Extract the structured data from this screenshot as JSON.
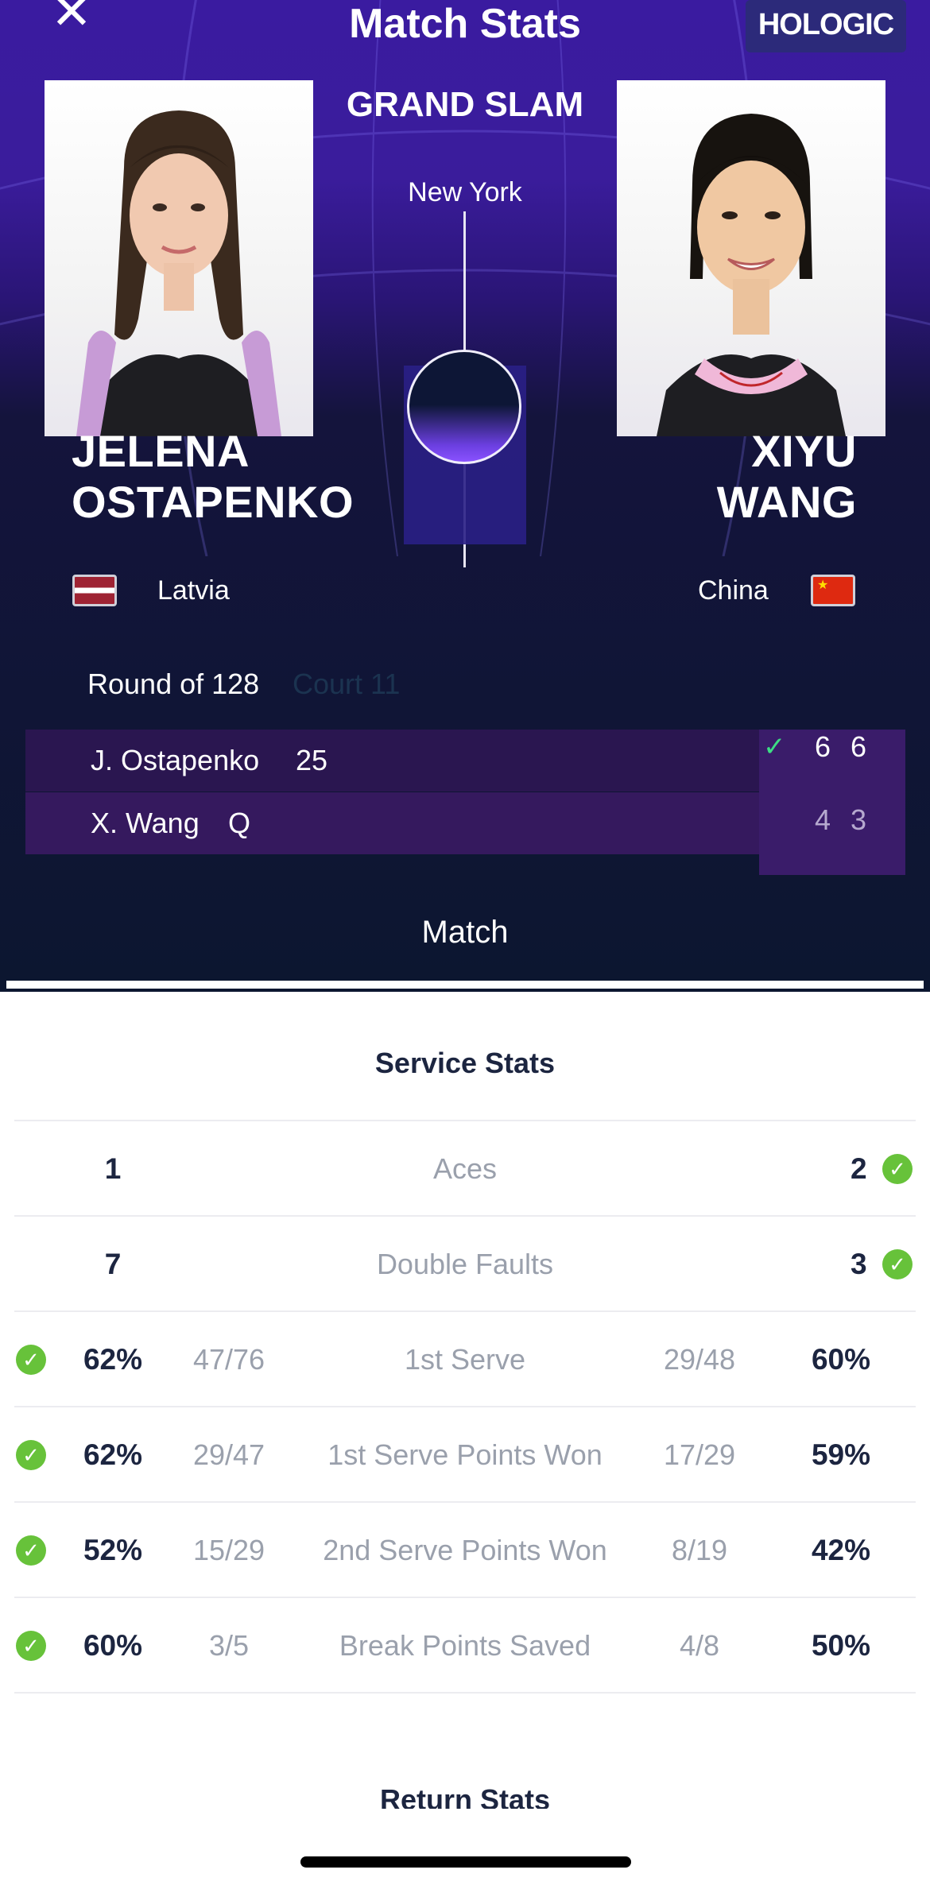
{
  "header": {
    "title": "Match Stats",
    "sponsor": "HOLOGIC",
    "event": "GRAND SLAM",
    "city": "New York"
  },
  "players": {
    "left": {
      "first": "JELENA",
      "last": "OSTAPENKO",
      "country": "Latvia",
      "short": "J. Ostapenko",
      "seed": "25",
      "sets": [
        "6",
        "6"
      ]
    },
    "right": {
      "first": "XIYU",
      "last": "WANG",
      "country": "China",
      "short": "X. Wang",
      "seed": "Q",
      "sets": [
        "4",
        "3"
      ]
    }
  },
  "match_info": {
    "round": "Round of 128",
    "court": "Court 11"
  },
  "tabs": {
    "active": "Match"
  },
  "service_stats": {
    "title": "Service Stats",
    "rows": [
      {
        "label": "Aces",
        "left_value": "1",
        "right_value": "2",
        "winner": "right"
      },
      {
        "label": "Double Faults",
        "left_value": "7",
        "right_value": "3",
        "winner": "right"
      },
      {
        "label": "1st Serve",
        "left_value": "62%",
        "left_fraction": "47/76",
        "right_fraction": "29/48",
        "right_value": "60%",
        "winner": "left"
      },
      {
        "label": "1st Serve Points Won",
        "left_value": "62%",
        "left_fraction": "29/47",
        "right_fraction": "17/29",
        "right_value": "59%",
        "winner": "left"
      },
      {
        "label": "2nd Serve Points Won",
        "left_value": "52%",
        "left_fraction": "15/29",
        "right_fraction": "8/19",
        "right_value": "42%",
        "winner": "left"
      },
      {
        "label": "Break Points Saved",
        "left_value": "60%",
        "left_fraction": "3/5",
        "right_fraction": "4/8",
        "right_value": "50%",
        "winner": "left"
      }
    ]
  },
  "return_stats": {
    "title": "Return Stats"
  },
  "colors": {
    "winner_check": "#67c23a",
    "set_win_check": "#3ddc84",
    "hero_purple": "#3a1ba0",
    "hero_navy": "#0c1630"
  },
  "icons": {
    "close": "close-icon",
    "winner": "check-circle-icon",
    "set_winner": "checkmark-icon"
  }
}
